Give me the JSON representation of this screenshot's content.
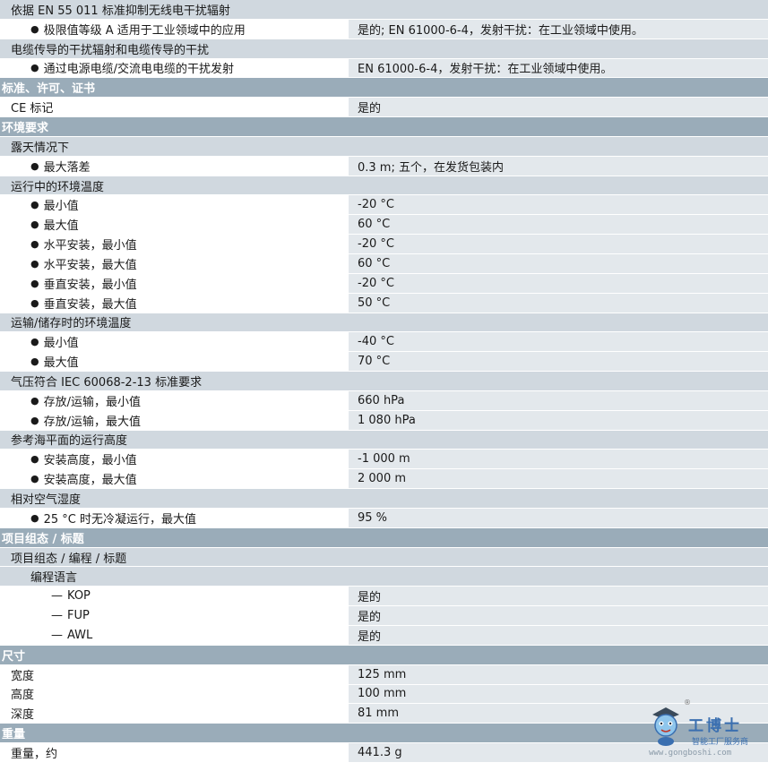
{
  "rows": [
    {
      "type": "sub",
      "level": 0,
      "label": "依据 EN 55 011 标准抑制无线电干扰辐射",
      "value": ""
    },
    {
      "type": "item",
      "level": 1,
      "marker": "bullet",
      "label": "极限值等级 A 适用于工业领域中的应用",
      "value": "是的; EN 61000-6-4，发射干扰：在工业领域中使用。"
    },
    {
      "type": "sub",
      "level": 0,
      "label": "电缆传导的干扰辐射和电缆传导的干扰",
      "value": ""
    },
    {
      "type": "item",
      "level": 1,
      "marker": "bullet",
      "label": "通过电源电缆/交流电电缆的干扰发射",
      "value": "EN 61000-6-4，发射干扰：在工业领域中使用。"
    },
    {
      "type": "section",
      "label": "标准、许可、证书"
    },
    {
      "type": "item",
      "level": 0,
      "label": "CE 标记",
      "value": "是的"
    },
    {
      "type": "section",
      "label": "环境要求"
    },
    {
      "type": "sub",
      "level": 0,
      "label": "露天情况下",
      "value": ""
    },
    {
      "type": "item",
      "level": 1,
      "marker": "bullet",
      "label": "最大落差",
      "value": "0.3 m; 五个，在发货包装内"
    },
    {
      "type": "sub",
      "level": 0,
      "label": "运行中的环境温度",
      "value": ""
    },
    {
      "type": "item",
      "level": 1,
      "marker": "bullet",
      "label": "最小值",
      "value": "-20 °C"
    },
    {
      "type": "item",
      "level": 1,
      "marker": "bullet",
      "label": "最大值",
      "value": "60 °C"
    },
    {
      "type": "item",
      "level": 1,
      "marker": "bullet",
      "label": "水平安装，最小值",
      "value": "-20 °C"
    },
    {
      "type": "item",
      "level": 1,
      "marker": "bullet",
      "label": "水平安装，最大值",
      "value": "60 °C"
    },
    {
      "type": "item",
      "level": 1,
      "marker": "bullet",
      "label": "垂直安装，最小值",
      "value": "-20 °C"
    },
    {
      "type": "item",
      "level": 1,
      "marker": "bullet",
      "label": "垂直安装，最大值",
      "value": "50 °C"
    },
    {
      "type": "sub",
      "level": 0,
      "label": "运输/储存时的环境温度",
      "value": ""
    },
    {
      "type": "item",
      "level": 1,
      "marker": "bullet",
      "label": "最小值",
      "value": "-40 °C"
    },
    {
      "type": "item",
      "level": 1,
      "marker": "bullet",
      "label": "最大值",
      "value": "70 °C"
    },
    {
      "type": "sub",
      "level": 0,
      "label": "气压符合 IEC 60068-2-13 标准要求",
      "value": ""
    },
    {
      "type": "item",
      "level": 1,
      "marker": "bullet",
      "label": "存放/运输，最小值",
      "value": "660 hPa"
    },
    {
      "type": "item",
      "level": 1,
      "marker": "bullet",
      "label": "存放/运输，最大值",
      "value": "1 080 hPa"
    },
    {
      "type": "sub",
      "level": 0,
      "label": "参考海平面的运行高度",
      "value": ""
    },
    {
      "type": "item",
      "level": 1,
      "marker": "bullet",
      "label": "安装高度，最小值",
      "value": "-1 000 m"
    },
    {
      "type": "item",
      "level": 1,
      "marker": "bullet",
      "label": "安装高度，最大值",
      "value": "2 000 m"
    },
    {
      "type": "sub",
      "level": 0,
      "label": "相对空气湿度",
      "value": ""
    },
    {
      "type": "item",
      "level": 1,
      "marker": "bullet",
      "label": "25 °C 时无冷凝运行，最大值",
      "value": "95 %"
    },
    {
      "type": "section",
      "label": "项目组态 / 标题"
    },
    {
      "type": "sub",
      "level": 0,
      "label": "项目组态 / 编程 / 标题",
      "value": ""
    },
    {
      "type": "sub",
      "level": 1,
      "label": "编程语言",
      "value": ""
    },
    {
      "type": "item",
      "level": 2,
      "marker": "dash",
      "label": "KOP",
      "value": "是的"
    },
    {
      "type": "item",
      "level": 2,
      "marker": "dash",
      "label": "FUP",
      "value": "是的"
    },
    {
      "type": "item",
      "level": 2,
      "marker": "dash",
      "label": "AWL",
      "value": "是的"
    },
    {
      "type": "section",
      "label": "尺寸"
    },
    {
      "type": "item",
      "level": 0,
      "label": "宽度",
      "value": "125 mm"
    },
    {
      "type": "item",
      "level": 0,
      "label": "高度",
      "value": "100 mm"
    },
    {
      "type": "item",
      "level": 0,
      "label": "深度",
      "value": "81 mm"
    },
    {
      "type": "section",
      "label": "重量"
    },
    {
      "type": "item",
      "level": 0,
      "label": "重量，约",
      "value": "441.3 g"
    }
  ],
  "markers": {
    "bullet": "●",
    "dash": "—"
  },
  "watermark": {
    "brand": "工博士",
    "registered": "®",
    "slogan": "智能工厂服务商",
    "url": "www.gongboshi.com"
  }
}
